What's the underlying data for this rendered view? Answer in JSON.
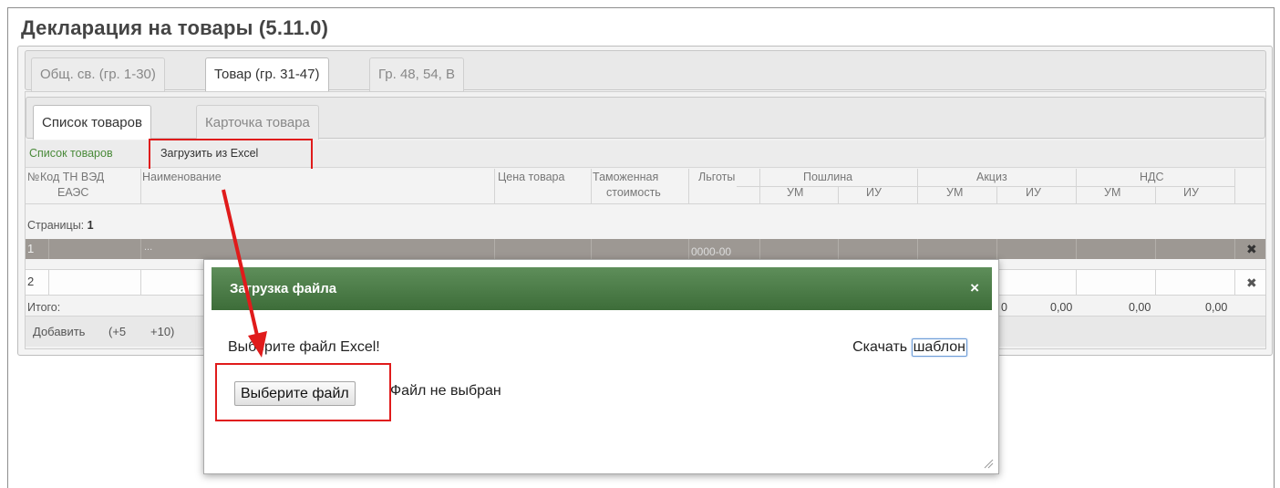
{
  "page": {
    "title": "Декларация на товары (5.11.0)"
  },
  "tabs": [
    {
      "label": "Общ. св. (гр. 1-30)"
    },
    {
      "label": "Товар (гр. 31-47)"
    },
    {
      "label": "Гр. 48, 54, В"
    }
  ],
  "subtabs": [
    {
      "label": "Список товаров"
    },
    {
      "label": "Карточка товара"
    }
  ],
  "toolbar": {
    "breadcrumb": "Список товаров",
    "upload_excel": "Загрузить из Excel"
  },
  "table": {
    "headers": {
      "num": "№",
      "code_line1": "Код ТН ВЭД",
      "code_line2": "ЕАЭС",
      "name": "Наименование",
      "price": "Цена товара",
      "customs_line1": "Таможенная",
      "customs_line2": "стоимость",
      "benefits": "Льготы",
      "duty": "Пошлина",
      "excise": "Акциз",
      "vat": "НДС",
      "um": "УМ",
      "iu": "ИУ"
    },
    "pages_label": "Страницы:",
    "pages_value": "1",
    "rows": [
      {
        "num": "1",
        "name": "...",
        "benefits": "0000-00"
      },
      {
        "num": "2"
      }
    ],
    "total_label": "Итого:",
    "totals": [
      "0,00",
      "0,00",
      "0,00"
    ],
    "total_partial": "0",
    "add_label": "Добавить",
    "add_plus5": "(+5",
    "add_plus10": "+10)"
  },
  "modal": {
    "title": "Загрузка файла",
    "close_glyph": "×",
    "message": "Выберите файл Excel!",
    "download_prefix": "Скачать",
    "download_link": "шаблон",
    "file_button": "Выберите файл",
    "file_status": "Файл не выбран"
  },
  "icons": {
    "delete": "✖"
  },
  "colors": {
    "header_green": "#4a7a46",
    "highlight_red": "#e01b1b",
    "selected_row": "#9d9893",
    "link_green": "#4a8a3a"
  }
}
